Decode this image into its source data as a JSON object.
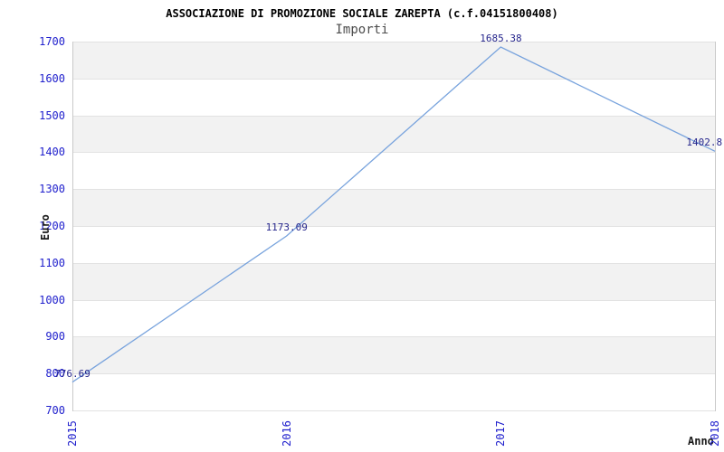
{
  "chart_data": {
    "type": "line",
    "title": "ASSOCIAZIONE DI PROMOZIONE SOCIALE ZAREPTA (c.f.04151800408)",
    "subtitle": "Importi",
    "xlabel": "Anno",
    "ylabel": "Euro",
    "categories": [
      "2015",
      "2016",
      "2017",
      "2018"
    ],
    "series": [
      {
        "name": "Importi",
        "values": [
          776.69,
          1173.09,
          1685.38,
          1402.8
        ]
      }
    ],
    "point_labels": [
      "776.69",
      "1173.09",
      "1685.38",
      "1402.8"
    ],
    "ylim": [
      700,
      1700
    ],
    "yticks": [
      700,
      800,
      900,
      1000,
      1100,
      1200,
      1300,
      1400,
      1500,
      1600,
      1700
    ],
    "grid": "alternating-horizontal-bands",
    "legend": "none",
    "colors": {
      "line": "#78a3dd",
      "tick_label": "#2121cd",
      "point_label": "#26268c",
      "band_fill": "#f2f2f2",
      "band_alt_fill": "#ffffff",
      "grid_line": "#e2e2e2",
      "plot_border": "#c9c9c9",
      "title_text": "#000000",
      "subtitle_text": "#4d4d4d",
      "axis_title_text": "#1a1a1a",
      "background": "#ffffff"
    }
  }
}
